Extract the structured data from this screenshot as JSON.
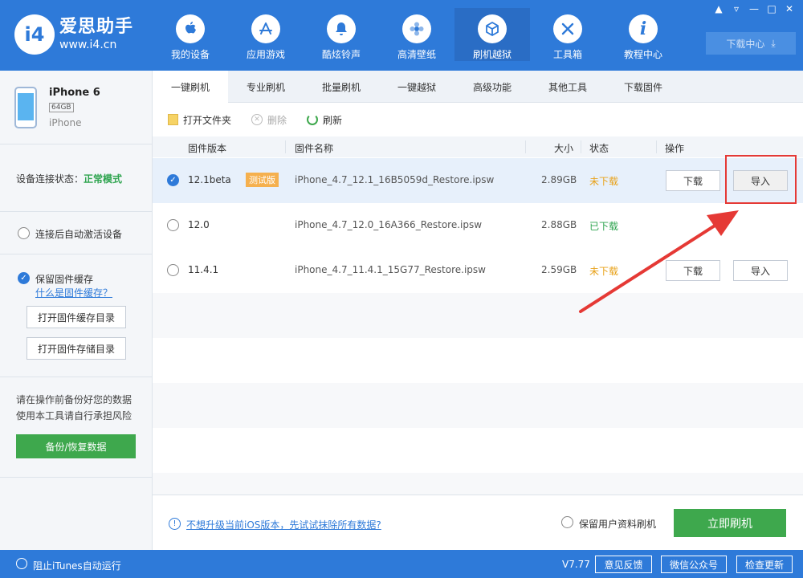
{
  "app": {
    "logo_mark": "i4",
    "logo_title": "爱思助手",
    "logo_url": "www.i4.cn",
    "accent": "#2e7ad9"
  },
  "nav": [
    {
      "label": "我的设备",
      "icon": "apple-icon"
    },
    {
      "label": "应用游戏",
      "icon": "app-store-icon"
    },
    {
      "label": "酷炫铃声",
      "icon": "bell-icon"
    },
    {
      "label": "高清壁纸",
      "icon": "flower-icon"
    },
    {
      "label": "刷机越狱",
      "icon": "box-icon"
    },
    {
      "label": "工具箱",
      "icon": "tools-icon"
    },
    {
      "label": "教程中心",
      "icon": "info-icon"
    }
  ],
  "download_center": "下载中心",
  "device": {
    "name": "iPhone 6",
    "capacity": "64GB",
    "type": "iPhone"
  },
  "status": {
    "label": "设备连接状态：",
    "value": "正常模式"
  },
  "sidebar": {
    "auto_activate": "连接后自动激活设备",
    "keep_cache": "保留固件缓存",
    "what_is_cache": "什么是固件缓存？",
    "open_cache_dir": "打开固件缓存目录",
    "open_store_dir": "打开固件存储目录",
    "warning_line1": "请在操作前备份好您的数据",
    "warning_line2": "使用本工具请自行承担风险",
    "backup_button": "备份/恢复数据"
  },
  "tabs": [
    "一键刷机",
    "专业刷机",
    "批量刷机",
    "一键越狱",
    "高级功能",
    "其他工具",
    "下载固件"
  ],
  "toolbar": {
    "open_folder": "打开文件夹",
    "delete": "删除",
    "refresh": "刷新"
  },
  "table": {
    "headers": {
      "version": "固件版本",
      "name": "固件名称",
      "size": "大小",
      "status": "状态",
      "action": "操作"
    },
    "rows": [
      {
        "version": "12.1beta",
        "badge": "测试版",
        "name": "iPhone_4.7_12.1_16B5059d_Restore.ipsw",
        "size": "2.89GB",
        "status": "未下载",
        "download": "下载",
        "import": "导入"
      },
      {
        "version": "12.0",
        "name": "iPhone_4.7_12.0_16A366_Restore.ipsw",
        "size": "2.88GB",
        "status": "已下载"
      },
      {
        "version": "11.4.1",
        "name": "iPhone_4.7_11.4.1_15G77_Restore.ipsw",
        "size": "2.59GB",
        "status": "未下载",
        "download": "下载",
        "import": "导入"
      }
    ]
  },
  "footer": {
    "erase_link": "不想升级当前iOS版本，先试试抹除所有数据?",
    "keep_user_data": "保留用户资料刷机",
    "flash_now": "立即刷机"
  },
  "statusbar": {
    "block_itunes": "阻止iTunes自动运行",
    "version": "V7.77",
    "feedback": "意见反馈",
    "wechat": "微信公众号",
    "check_update": "检查更新"
  }
}
